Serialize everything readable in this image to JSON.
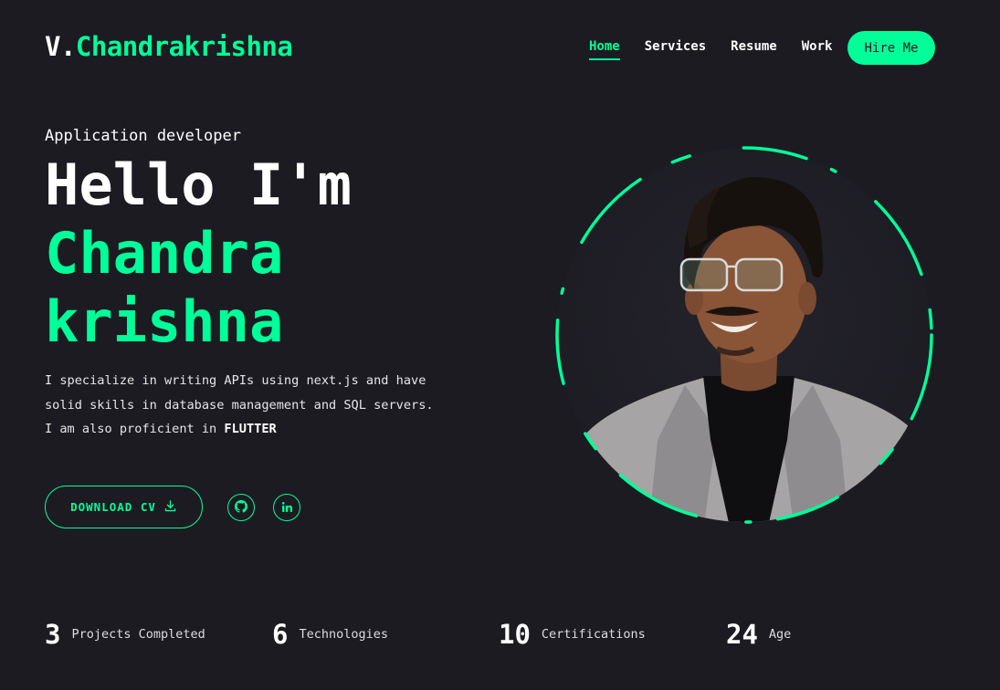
{
  "header": {
    "logo_prefix": "V.",
    "logo_name": "Chandrakrishna",
    "nav": [
      "Home",
      "Services",
      "Resume",
      "Work"
    ],
    "hire_label": "Hire Me"
  },
  "hero": {
    "role": "Application developer",
    "greeting": "Hello I'm",
    "name_line1": "Chandra",
    "name_line2": "krishna",
    "bio_line1": "I specialize in writing APIs using next.js and have",
    "bio_line2": "solid skills in database management and SQL servers.",
    "bio_line3_prefix": "I am also proficient in ",
    "bio_line3_bold": "FLUTTER",
    "cv_label": "DOWNLOAD CV"
  },
  "social": {
    "github_icon": "github-icon",
    "linkedin_icon": "linkedin-icon"
  },
  "stats": [
    {
      "value": "3",
      "label": "Projects Completed"
    },
    {
      "value": "6",
      "label": "Technologies"
    },
    {
      "value": "10",
      "label": "Certifications"
    },
    {
      "value": "24",
      "label": "Age"
    }
  ],
  "colors": {
    "background": "#1c1b22",
    "accent": "#00ff99",
    "text": "#ffffff"
  }
}
